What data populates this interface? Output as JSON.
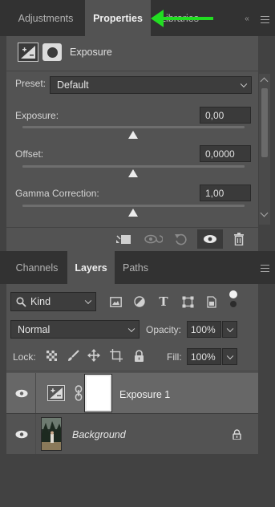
{
  "top_tabs": {
    "adjustments": "Adjustments",
    "properties": "Properties",
    "libraries": "Libraries"
  },
  "properties": {
    "title": "Exposure",
    "preset_label": "Preset:",
    "preset_value": "Default",
    "exposure_label": "Exposure:",
    "exposure_value": "0,00",
    "offset_label": "Offset:",
    "offset_value": "0,0000",
    "gamma_label": "Gamma Correction:",
    "gamma_value": "1,00"
  },
  "bottom_tabs": {
    "channels": "Channels",
    "layers": "Layers",
    "paths": "Paths"
  },
  "layers": {
    "filter_value": "Kind",
    "blend_mode": "Normal",
    "opacity_label": "Opacity:",
    "opacity_value": "100%",
    "lock_label": "Lock:",
    "fill_label": "Fill:",
    "fill_value": "100%",
    "items": [
      {
        "name": "Exposure 1"
      },
      {
        "name": "Background"
      }
    ]
  },
  "colors": {
    "annotation_arrow": "#22dd22",
    "panel": "#535353",
    "tabbar": "#323232"
  }
}
